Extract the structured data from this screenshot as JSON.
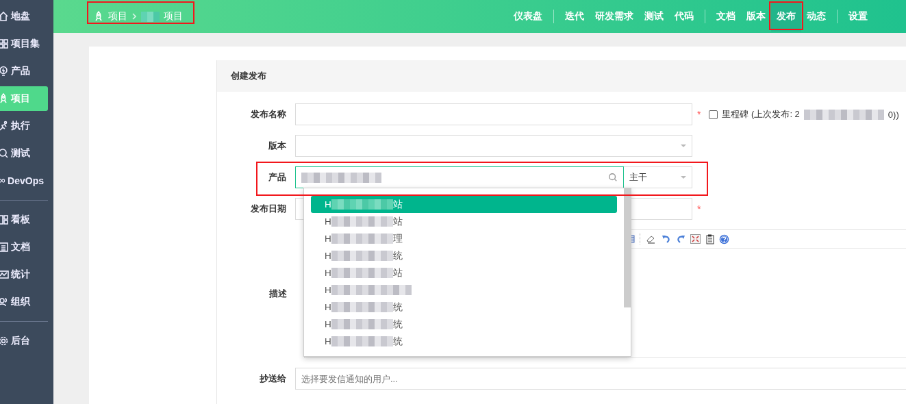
{
  "sidebar": {
    "items": [
      {
        "label": "地盘",
        "selected": false
      },
      {
        "label": "项目集",
        "selected": false
      },
      {
        "label": "产品",
        "selected": false
      },
      {
        "label": "项目",
        "selected": true
      },
      {
        "label": "执行",
        "selected": false
      },
      {
        "label": "测试",
        "selected": false
      },
      {
        "label": "DevOps",
        "selected": false
      },
      {
        "label": "看板",
        "selected": false
      },
      {
        "label": "文档",
        "selected": false
      },
      {
        "label": "统计",
        "selected": false
      },
      {
        "label": "组织",
        "selected": false
      },
      {
        "label": "后台",
        "selected": false
      }
    ]
  },
  "breadcrumb": {
    "root": "项目",
    "current": "项目"
  },
  "nav": [
    {
      "label": "仪表盘",
      "selected": false
    },
    {
      "label": "迭代",
      "selected": false
    },
    {
      "label": "研发需求",
      "selected": false
    },
    {
      "label": "测试",
      "selected": false
    },
    {
      "label": "代码",
      "selected": false
    },
    {
      "label": "文档",
      "selected": false
    },
    {
      "label": "版本",
      "selected": false
    },
    {
      "label": "发布",
      "selected": true
    },
    {
      "label": "动态",
      "selected": false
    },
    {
      "label": "设置",
      "selected": false
    }
  ],
  "form": {
    "title": "创建发布",
    "name_label": "发布名称",
    "required_mark": "*",
    "milestone": {
      "label": "里程碑 (上次发布: 2",
      "tail": "0))",
      "checked": false
    },
    "build_label": "版本",
    "product_label": "产品",
    "branch": "主干",
    "date_label": "发布日期",
    "date_required_mark": "*",
    "desc_label": "描述",
    "notify_label": "抄送给",
    "notify_placeholder": "选择要发信通知的用户..."
  },
  "dropdown": {
    "options": [
      {
        "prefix": "H",
        "suffix": "站",
        "selected": true
      },
      {
        "prefix": "H",
        "suffix": "站",
        "selected": false
      },
      {
        "prefix": "H",
        "suffix": "理",
        "selected": false
      },
      {
        "prefix": "H",
        "suffix": "统",
        "selected": false
      },
      {
        "prefix": "H",
        "suffix": "站",
        "selected": false
      },
      {
        "prefix": "H",
        "selected": false
      },
      {
        "prefix": "H",
        "suffix": "统",
        "selected": false
      },
      {
        "prefix": "H",
        "suffix": "统",
        "selected": false
      },
      {
        "prefix": "H",
        "suffix": "统",
        "selected": false
      }
    ]
  }
}
